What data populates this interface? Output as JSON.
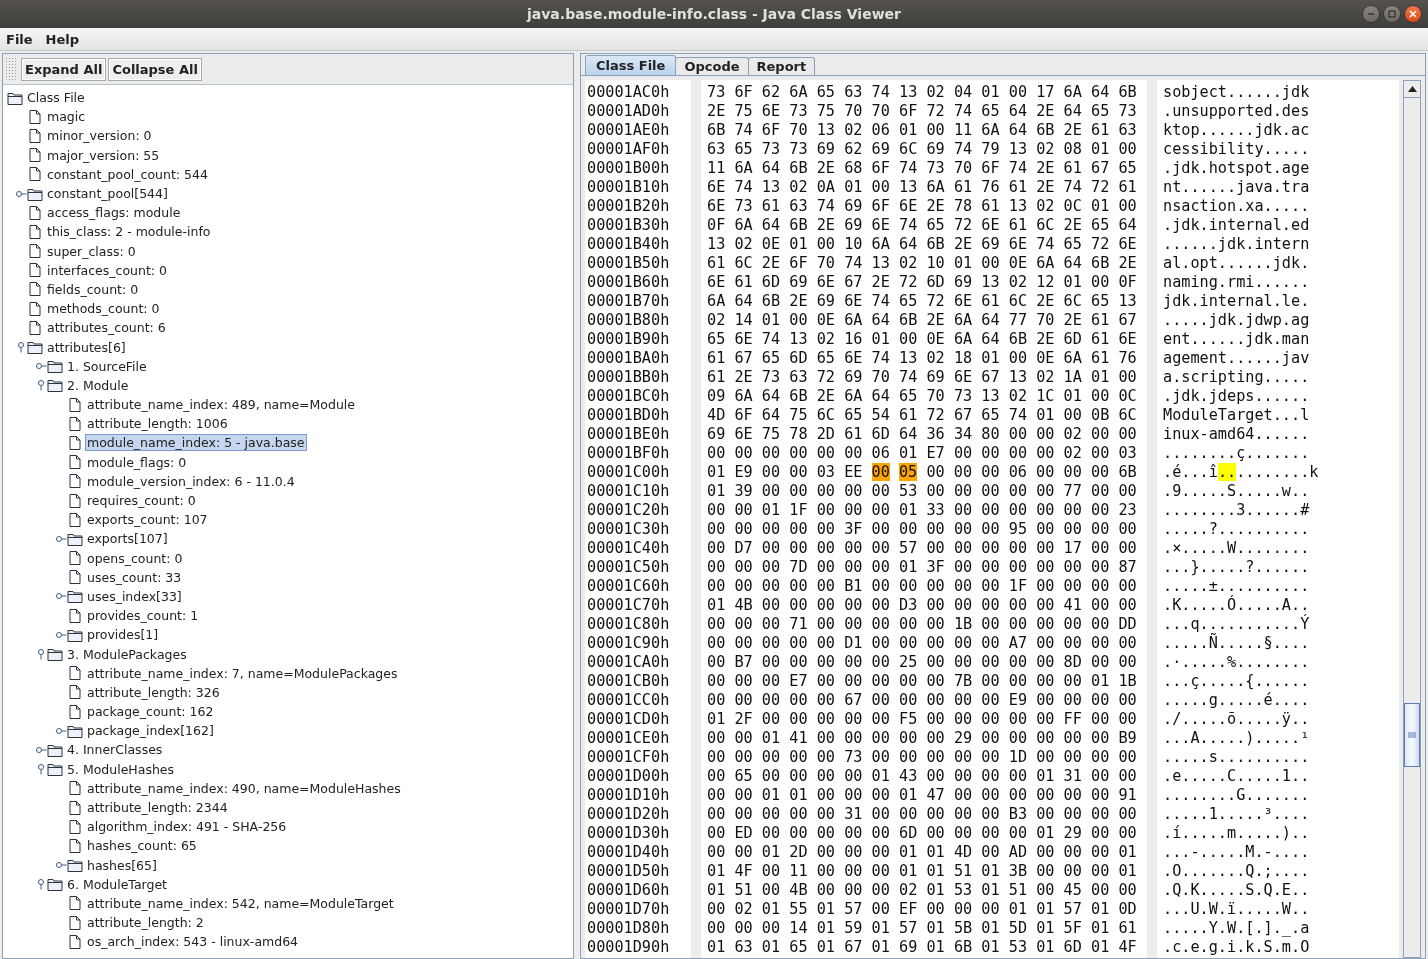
{
  "window": {
    "title": "java.base.module-info.class - Java Class Viewer"
  },
  "menu": [
    {
      "label": "File"
    },
    {
      "label": "Help"
    }
  ],
  "toolbar": {
    "buttons": [
      {
        "label": "Expand All"
      },
      {
        "label": "Collapse All"
      }
    ]
  },
  "tree": {
    "items": [
      {
        "label": "Class File",
        "kind": "folder",
        "selected": false,
        "children": [
          {
            "label": "magic",
            "kind": "leaf",
            "selected": false
          },
          {
            "label": "minor_version: 0",
            "kind": "leaf",
            "selected": false
          },
          {
            "label": "major_version: 55",
            "kind": "leaf",
            "selected": false
          },
          {
            "label": "constant_pool_count: 544",
            "kind": "leaf",
            "selected": false
          },
          {
            "label": "constant_pool[544]",
            "kind": "folder",
            "expanded": false,
            "selected": false
          },
          {
            "label": "access_flags: module",
            "kind": "leaf",
            "selected": false
          },
          {
            "label": "this_class: 2 - module-info",
            "kind": "leaf",
            "selected": false
          },
          {
            "label": "super_class: 0",
            "kind": "leaf",
            "selected": false
          },
          {
            "label": "interfaces_count: 0",
            "kind": "leaf",
            "selected": false
          },
          {
            "label": "fields_count: 0",
            "kind": "leaf",
            "selected": false
          },
          {
            "label": "methods_count: 0",
            "kind": "leaf",
            "selected": false
          },
          {
            "label": "attributes_count: 6",
            "kind": "leaf",
            "selected": false
          },
          {
            "label": "attributes[6]",
            "kind": "folder",
            "expanded": true,
            "selected": false,
            "children": [
              {
                "label": "1. SourceFile",
                "kind": "folder",
                "expanded": false,
                "selected": false
              },
              {
                "label": "2. Module",
                "kind": "folder",
                "expanded": true,
                "selected": false,
                "children": [
                  {
                    "label": "attribute_name_index: 489, name=Module",
                    "kind": "leaf",
                    "selected": false
                  },
                  {
                    "label": "attribute_length: 1006",
                    "kind": "leaf",
                    "selected": false
                  },
                  {
                    "label": "module_name_index: 5 - java.base",
                    "kind": "leaf",
                    "selected": true
                  },
                  {
                    "label": "module_flags: 0",
                    "kind": "leaf",
                    "selected": false
                  },
                  {
                    "label": "module_version_index: 6 - 11.0.4",
                    "kind": "leaf",
                    "selected": false
                  },
                  {
                    "label": "requires_count: 0",
                    "kind": "leaf",
                    "selected": false
                  },
                  {
                    "label": "exports_count: 107",
                    "kind": "leaf",
                    "selected": false
                  },
                  {
                    "label": "exports[107]",
                    "kind": "folder",
                    "expanded": false,
                    "selected": false
                  },
                  {
                    "label": "opens_count: 0",
                    "kind": "leaf",
                    "selected": false
                  },
                  {
                    "label": "uses_count: 33",
                    "kind": "leaf",
                    "selected": false
                  },
                  {
                    "label": "uses_index[33]",
                    "kind": "folder",
                    "expanded": false,
                    "selected": false
                  },
                  {
                    "label": "provides_count: 1",
                    "kind": "leaf",
                    "selected": false
                  },
                  {
                    "label": "provides[1]",
                    "kind": "folder",
                    "expanded": false,
                    "selected": false
                  }
                ]
              },
              {
                "label": "3. ModulePackages",
                "kind": "folder",
                "expanded": true,
                "selected": false,
                "children": [
                  {
                    "label": "attribute_name_index: 7, name=ModulePackages",
                    "kind": "leaf",
                    "selected": false
                  },
                  {
                    "label": "attribute_length: 326",
                    "kind": "leaf",
                    "selected": false
                  },
                  {
                    "label": "package_count: 162",
                    "kind": "leaf",
                    "selected": false
                  },
                  {
                    "label": "package_index[162]",
                    "kind": "folder",
                    "expanded": false,
                    "selected": false
                  }
                ]
              },
              {
                "label": "4. InnerClasses",
                "kind": "folder",
                "expanded": false,
                "selected": false
              },
              {
                "label": "5. ModuleHashes",
                "kind": "folder",
                "expanded": true,
                "selected": false,
                "children": [
                  {
                    "label": "attribute_name_index: 490, name=ModuleHashes",
                    "kind": "leaf",
                    "selected": false
                  },
                  {
                    "label": "attribute_length: 2344",
                    "kind": "leaf",
                    "selected": false
                  },
                  {
                    "label": "algorithm_index: 491 - SHA-256",
                    "kind": "leaf",
                    "selected": false
                  },
                  {
                    "label": "hashes_count: 65",
                    "kind": "leaf",
                    "selected": false
                  },
                  {
                    "label": "hashes[65]",
                    "kind": "folder",
                    "expanded": false,
                    "selected": false
                  }
                ]
              },
              {
                "label": "6. ModuleTarget",
                "kind": "folder",
                "expanded": true,
                "selected": false,
                "children": [
                  {
                    "label": "attribute_name_index: 542, name=ModuleTarget",
                    "kind": "leaf",
                    "selected": false
                  },
                  {
                    "label": "attribute_length: 2",
                    "kind": "leaf",
                    "selected": false
                  },
                  {
                    "label": "os_arch_index: 543 - linux-amd64",
                    "kind": "leaf",
                    "selected": false
                  }
                ]
              }
            ]
          }
        ]
      }
    ]
  },
  "tabs": [
    {
      "label": "Class File",
      "selected": true
    },
    {
      "label": "Opcode",
      "selected": false
    },
    {
      "label": "Report",
      "selected": false
    }
  ],
  "hex_view": {
    "rows": [
      {
        "offset": "00001AC0h",
        "hex": [
          {
            "text": "73 6F 62 6A 65 63 74 13 02 04 01 00 17 6A 64 6B",
            "selected": false
          }
        ],
        "ascii": [
          {
            "text": "sobject......jdk",
            "selected": false
          }
        ]
      },
      {
        "offset": "00001AD0h",
        "hex": [
          {
            "text": "2E 75 6E 73 75 70 70 6F 72 74 65 64 2E 64 65 73",
            "selected": false
          }
        ],
        "ascii": [
          {
            "text": ".unsupported.des",
            "selected": false
          }
        ]
      },
      {
        "offset": "00001AE0h",
        "hex": [
          {
            "text": "6B 74 6F 70 13 02 06 01 00 11 6A 64 6B 2E 61 63",
            "selected": false
          }
        ],
        "ascii": [
          {
            "text": "ktop......jdk.ac",
            "selected": false
          }
        ]
      },
      {
        "offset": "00001AF0h",
        "hex": [
          {
            "text": "63 65 73 73 69 62 69 6C 69 74 79 13 02 08 01 00",
            "selected": false
          }
        ],
        "ascii": [
          {
            "text": "cessibility.....",
            "selected": false
          }
        ]
      },
      {
        "offset": "00001B00h",
        "hex": [
          {
            "text": "11 6A 64 6B 2E 68 6F 74 73 70 6F 74 2E 61 67 65",
            "selected": false
          }
        ],
        "ascii": [
          {
            "text": ".jdk.hotspot.age",
            "selected": false
          }
        ]
      },
      {
        "offset": "00001B10h",
        "hex": [
          {
            "text": "6E 74 13 02 0A 01 00 13 6A 61 76 61 2E 74 72 61",
            "selected": false
          }
        ],
        "ascii": [
          {
            "text": "nt......java.tra",
            "selected": false
          }
        ]
      },
      {
        "offset": "00001B20h",
        "hex": [
          {
            "text": "6E 73 61 63 74 69 6F 6E 2E 78 61 13 02 0C 01 00",
            "selected": false
          }
        ],
        "ascii": [
          {
            "text": "nsaction.xa.....",
            "selected": false
          }
        ]
      },
      {
        "offset": "00001B30h",
        "hex": [
          {
            "text": "0F 6A 64 6B 2E 69 6E 74 65 72 6E 61 6C 2E 65 64",
            "selected": false
          }
        ],
        "ascii": [
          {
            "text": ".jdk.internal.ed",
            "selected": false
          }
        ]
      },
      {
        "offset": "00001B40h",
        "hex": [
          {
            "text": "13 02 0E 01 00 10 6A 64 6B 2E 69 6E 74 65 72 6E",
            "selected": false
          }
        ],
        "ascii": [
          {
            "text": "......jdk.intern",
            "selected": false
          }
        ]
      },
      {
        "offset": "00001B50h",
        "hex": [
          {
            "text": "61 6C 2E 6F 70 74 13 02 10 01 00 0E 6A 64 6B 2E",
            "selected": false
          }
        ],
        "ascii": [
          {
            "text": "al.opt......jdk.",
            "selected": false
          }
        ]
      },
      {
        "offset": "00001B60h",
        "hex": [
          {
            "text": "6E 61 6D 69 6E 67 2E 72 6D 69 13 02 12 01 00 0F",
            "selected": false
          }
        ],
        "ascii": [
          {
            "text": "naming.rmi......",
            "selected": false
          }
        ]
      },
      {
        "offset": "00001B70h",
        "hex": [
          {
            "text": "6A 64 6B 2E 69 6E 74 65 72 6E 61 6C 2E 6C 65 13",
            "selected": false
          }
        ],
        "ascii": [
          {
            "text": "jdk.internal.le.",
            "selected": false
          }
        ]
      },
      {
        "offset": "00001B80h",
        "hex": [
          {
            "text": "02 14 01 00 0E 6A 64 6B 2E 6A 64 77 70 2E 61 67",
            "selected": false
          }
        ],
        "ascii": [
          {
            "text": ".....jdk.jdwp.ag",
            "selected": false
          }
        ]
      },
      {
        "offset": "00001B90h",
        "hex": [
          {
            "text": "65 6E 74 13 02 16 01 00 0E 6A 64 6B 2E 6D 61 6E",
            "selected": false
          }
        ],
        "ascii": [
          {
            "text": "ent......jdk.man",
            "selected": false
          }
        ]
      },
      {
        "offset": "00001BA0h",
        "hex": [
          {
            "text": "61 67 65 6D 65 6E 74 13 02 18 01 00 0E 6A 61 76",
            "selected": false
          }
        ],
        "ascii": [
          {
            "text": "agement......jav",
            "selected": false
          }
        ]
      },
      {
        "offset": "00001BB0h",
        "hex": [
          {
            "text": "61 2E 73 63 72 69 70 74 69 6E 67 13 02 1A 01 00",
            "selected": false
          }
        ],
        "ascii": [
          {
            "text": "a.scripting.....",
            "selected": false
          }
        ]
      },
      {
        "offset": "00001BC0h",
        "hex": [
          {
            "text": "09 6A 64 6B 2E 6A 64 65 70 73 13 02 1C 01 00 0C",
            "selected": false
          }
        ],
        "ascii": [
          {
            "text": ".jdk.jdeps......",
            "selected": false
          }
        ]
      },
      {
        "offset": "00001BD0h",
        "hex": [
          {
            "text": "4D 6F 64 75 6C 65 54 61 72 67 65 74 01 00 0B 6C",
            "selected": false
          }
        ],
        "ascii": [
          {
            "text": "ModuleTarget...l",
            "selected": false
          }
        ]
      },
      {
        "offset": "00001BE0h",
        "hex": [
          {
            "text": "69 6E 75 78 2D 61 6D 64 36 34 80 00 00 02 00 00",
            "selected": false
          }
        ],
        "ascii": [
          {
            "text": "inux-amd64......",
            "selected": false
          }
        ]
      },
      {
        "offset": "00001BF0h",
        "hex": [
          {
            "text": "00 00 00 00 00 00 06 01 E7 00 00 00 00 02 00 03",
            "selected": false
          }
        ],
        "ascii": [
          {
            "text": "........ç.......",
            "selected": false
          }
        ]
      },
      {
        "offset": "00001C00h",
        "hex": [
          {
            "text": "01 E9 00 00 03 EE",
            "selected": false
          },
          {
            "text": "00",
            "selected": true
          },
          {
            "text": "05",
            "selected": true
          },
          {
            "text": "00 00 00 06 00 00 00 6B",
            "selected": false
          }
        ],
        "ascii": [
          {
            "text": ".é...î",
            "selected": false
          },
          {
            "text": "..",
            "selected": true
          },
          {
            "text": "........k",
            "selected": false
          }
        ]
      },
      {
        "offset": "00001C10h",
        "hex": [
          {
            "text": "01 39 00 00 00 00 00 53 00 00 00 00 00 77 00 00",
            "selected": false
          }
        ],
        "ascii": [
          {
            "text": ".9.....S.....w..",
            "selected": false
          }
        ]
      },
      {
        "offset": "00001C20h",
        "hex": [
          {
            "text": "00 00 01 1F 00 00 00 01 33 00 00 00 00 00 00 23",
            "selected": false
          }
        ],
        "ascii": [
          {
            "text": "........3......#",
            "selected": false
          }
        ]
      },
      {
        "offset": "00001C30h",
        "hex": [
          {
            "text": "00 00 00 00 00 3F 00 00 00 00 00 95 00 00 00 00",
            "selected": false
          }
        ],
        "ascii": [
          {
            "text": ".....?..........",
            "selected": false
          }
        ]
      },
      {
        "offset": "00001C40h",
        "hex": [
          {
            "text": "00 D7 00 00 00 00 00 57 00 00 00 00 00 17 00 00",
            "selected": false
          }
        ],
        "ascii": [
          {
            "text": ".×.....W........",
            "selected": false
          }
        ]
      },
      {
        "offset": "00001C50h",
        "hex": [
          {
            "text": "00 00 00 7D 00 00 00 01 3F 00 00 00 00 00 00 87",
            "selected": false
          }
        ],
        "ascii": [
          {
            "text": "...}.....?......",
            "selected": false
          }
        ]
      },
      {
        "offset": "00001C60h",
        "hex": [
          {
            "text": "00 00 00 00 00 B1 00 00 00 00 00 1F 00 00 00 00",
            "selected": false
          }
        ],
        "ascii": [
          {
            "text": ".....±..........",
            "selected": false
          }
        ]
      },
      {
        "offset": "00001C70h",
        "hex": [
          {
            "text": "01 4B 00 00 00 00 00 D3 00 00 00 00 00 41 00 00",
            "selected": false
          }
        ],
        "ascii": [
          {
            "text": ".K.....Ó.....A..",
            "selected": false
          }
        ]
      },
      {
        "offset": "00001C80h",
        "hex": [
          {
            "text": "00 00 00 71 00 00 00 00 00 1B 00 00 00 00 00 DD",
            "selected": false
          }
        ],
        "ascii": [
          {
            "text": "...q...........Ý",
            "selected": false
          }
        ]
      },
      {
        "offset": "00001C90h",
        "hex": [
          {
            "text": "00 00 00 00 00 D1 00 00 00 00 00 A7 00 00 00 00",
            "selected": false
          }
        ],
        "ascii": [
          {
            "text": ".....Ñ.....§....",
            "selected": false
          }
        ]
      },
      {
        "offset": "00001CA0h",
        "hex": [
          {
            "text": "00 B7 00 00 00 00 00 25 00 00 00 00 00 8D 00 00",
            "selected": false
          }
        ],
        "ascii": [
          {
            "text": ".·.....%........",
            "selected": false
          }
        ]
      },
      {
        "offset": "00001CB0h",
        "hex": [
          {
            "text": "00 00 00 E7 00 00 00 00 00 7B 00 00 00 00 01 1B",
            "selected": false
          }
        ],
        "ascii": [
          {
            "text": "...ç.....{......",
            "selected": false
          }
        ]
      },
      {
        "offset": "00001CC0h",
        "hex": [
          {
            "text": "00 00 00 00 00 67 00 00 00 00 00 E9 00 00 00 00",
            "selected": false
          }
        ],
        "ascii": [
          {
            "text": ".....g.....é....",
            "selected": false
          }
        ]
      },
      {
        "offset": "00001CD0h",
        "hex": [
          {
            "text": "01 2F 00 00 00 00 00 F5 00 00 00 00 00 FF 00 00",
            "selected": false
          }
        ],
        "ascii": [
          {
            "text": "./.....õ.....ÿ..",
            "selected": false
          }
        ]
      },
      {
        "offset": "00001CE0h",
        "hex": [
          {
            "text": "00 00 01 41 00 00 00 00 00 29 00 00 00 00 00 B9",
            "selected": false
          }
        ],
        "ascii": [
          {
            "text": "...A.....).....¹",
            "selected": false
          }
        ]
      },
      {
        "offset": "00001CF0h",
        "hex": [
          {
            "text": "00 00 00 00 00 73 00 00 00 00 00 1D 00 00 00 00",
            "selected": false
          }
        ],
        "ascii": [
          {
            "text": ".....s..........",
            "selected": false
          }
        ]
      },
      {
        "offset": "00001D00h",
        "hex": [
          {
            "text": "00 65 00 00 00 00 01 43 00 00 00 00 01 31 00 00",
            "selected": false
          }
        ],
        "ascii": [
          {
            "text": ".e.....C.....1..",
            "selected": false
          }
        ]
      },
      {
        "offset": "00001D10h",
        "hex": [
          {
            "text": "00 00 01 01 00 00 00 01 47 00 00 00 00 00 00 91",
            "selected": false
          }
        ],
        "ascii": [
          {
            "text": "........G.......",
            "selected": false
          }
        ]
      },
      {
        "offset": "00001D20h",
        "hex": [
          {
            "text": "00 00 00 00 00 31 00 00 00 00 00 B3 00 00 00 00",
            "selected": false
          }
        ],
        "ascii": [
          {
            "text": ".....1.....³....",
            "selected": false
          }
        ]
      },
      {
        "offset": "00001D30h",
        "hex": [
          {
            "text": "00 ED 00 00 00 00 00 6D 00 00 00 00 01 29 00 00",
            "selected": false
          }
        ],
        "ascii": [
          {
            "text": ".í.....m.....)..",
            "selected": false
          }
        ]
      },
      {
        "offset": "00001D40h",
        "hex": [
          {
            "text": "00 00 01 2D 00 00 00 01 01 4D 00 AD 00 00 00 01",
            "selected": false
          }
        ],
        "ascii": [
          {
            "text": "...-.....M.-....",
            "selected": false
          }
        ]
      },
      {
        "offset": "00001D50h",
        "hex": [
          {
            "text": "01 4F 00 11 00 00 00 01 01 51 01 3B 00 00 00 01",
            "selected": false
          }
        ],
        "ascii": [
          {
            "text": ".O.......Q.;....",
            "selected": false
          }
        ]
      },
      {
        "offset": "00001D60h",
        "hex": [
          {
            "text": "01 51 00 4B 00 00 00 02 01 53 01 51 00 45 00 00",
            "selected": false
          }
        ],
        "ascii": [
          {
            "text": ".Q.K.....S.Q.E..",
            "selected": false
          }
        ]
      },
      {
        "offset": "00001D70h",
        "hex": [
          {
            "text": "00 02 01 55 01 57 00 EF 00 00 00 01 01 57 01 0D",
            "selected": false
          }
        ],
        "ascii": [
          {
            "text": "...U.W.ï.....W..",
            "selected": false
          }
        ]
      },
      {
        "offset": "00001D80h",
        "hex": [
          {
            "text": "00 00 00 14 01 59 01 57 01 5B 01 5D 01 5F 01 61",
            "selected": false
          }
        ],
        "ascii": [
          {
            "text": ".....Y.W.[.]._.a",
            "selected": false
          }
        ]
      },
      {
        "offset": "00001D90h",
        "hex": [
          {
            "text": "01 63 01 65 01 67 01 69 01 6B 01 53 01 6D 01 4F",
            "selected": false
          }
        ],
        "ascii": [
          {
            "text": ".c.e.g.i.k.S.m.O",
            "selected": false
          }
        ]
      }
    ]
  }
}
